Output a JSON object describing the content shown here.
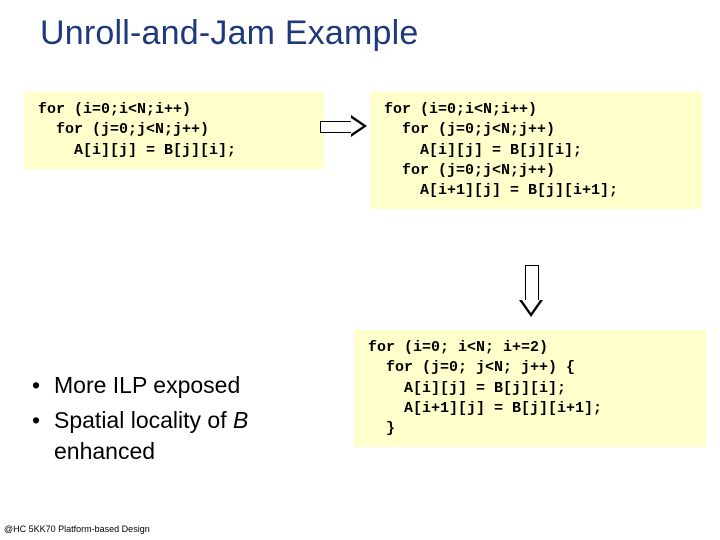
{
  "title": "Unroll-and-Jam Example",
  "code_left": "for (i=0;i<N;i++)\n  for (j=0;j<N;j++)\n    A[i][j] = B[j][i];",
  "code_right": "for (i=0;i<N;i++)\n  for (j=0;j<N;j++)\n    A[i][j] = B[j][i];\n  for (j=0;j<N;j++)\n    A[i+1][j] = B[j][i+1];",
  "code_bottom": "for (i=0; i<N; i+=2)\n  for (j=0; j<N; j++) {\n    A[i][j] = B[j][i];\n    A[i+1][j] = B[j][i+1];\n  }",
  "bullets": {
    "item1_text": "More ILP exposed",
    "item2_prefix": "Spatial locality of ",
    "item2_italic": "B",
    "item2_suffix": " enhanced"
  },
  "footer": "@HC 5KK70 Platform-based Design"
}
